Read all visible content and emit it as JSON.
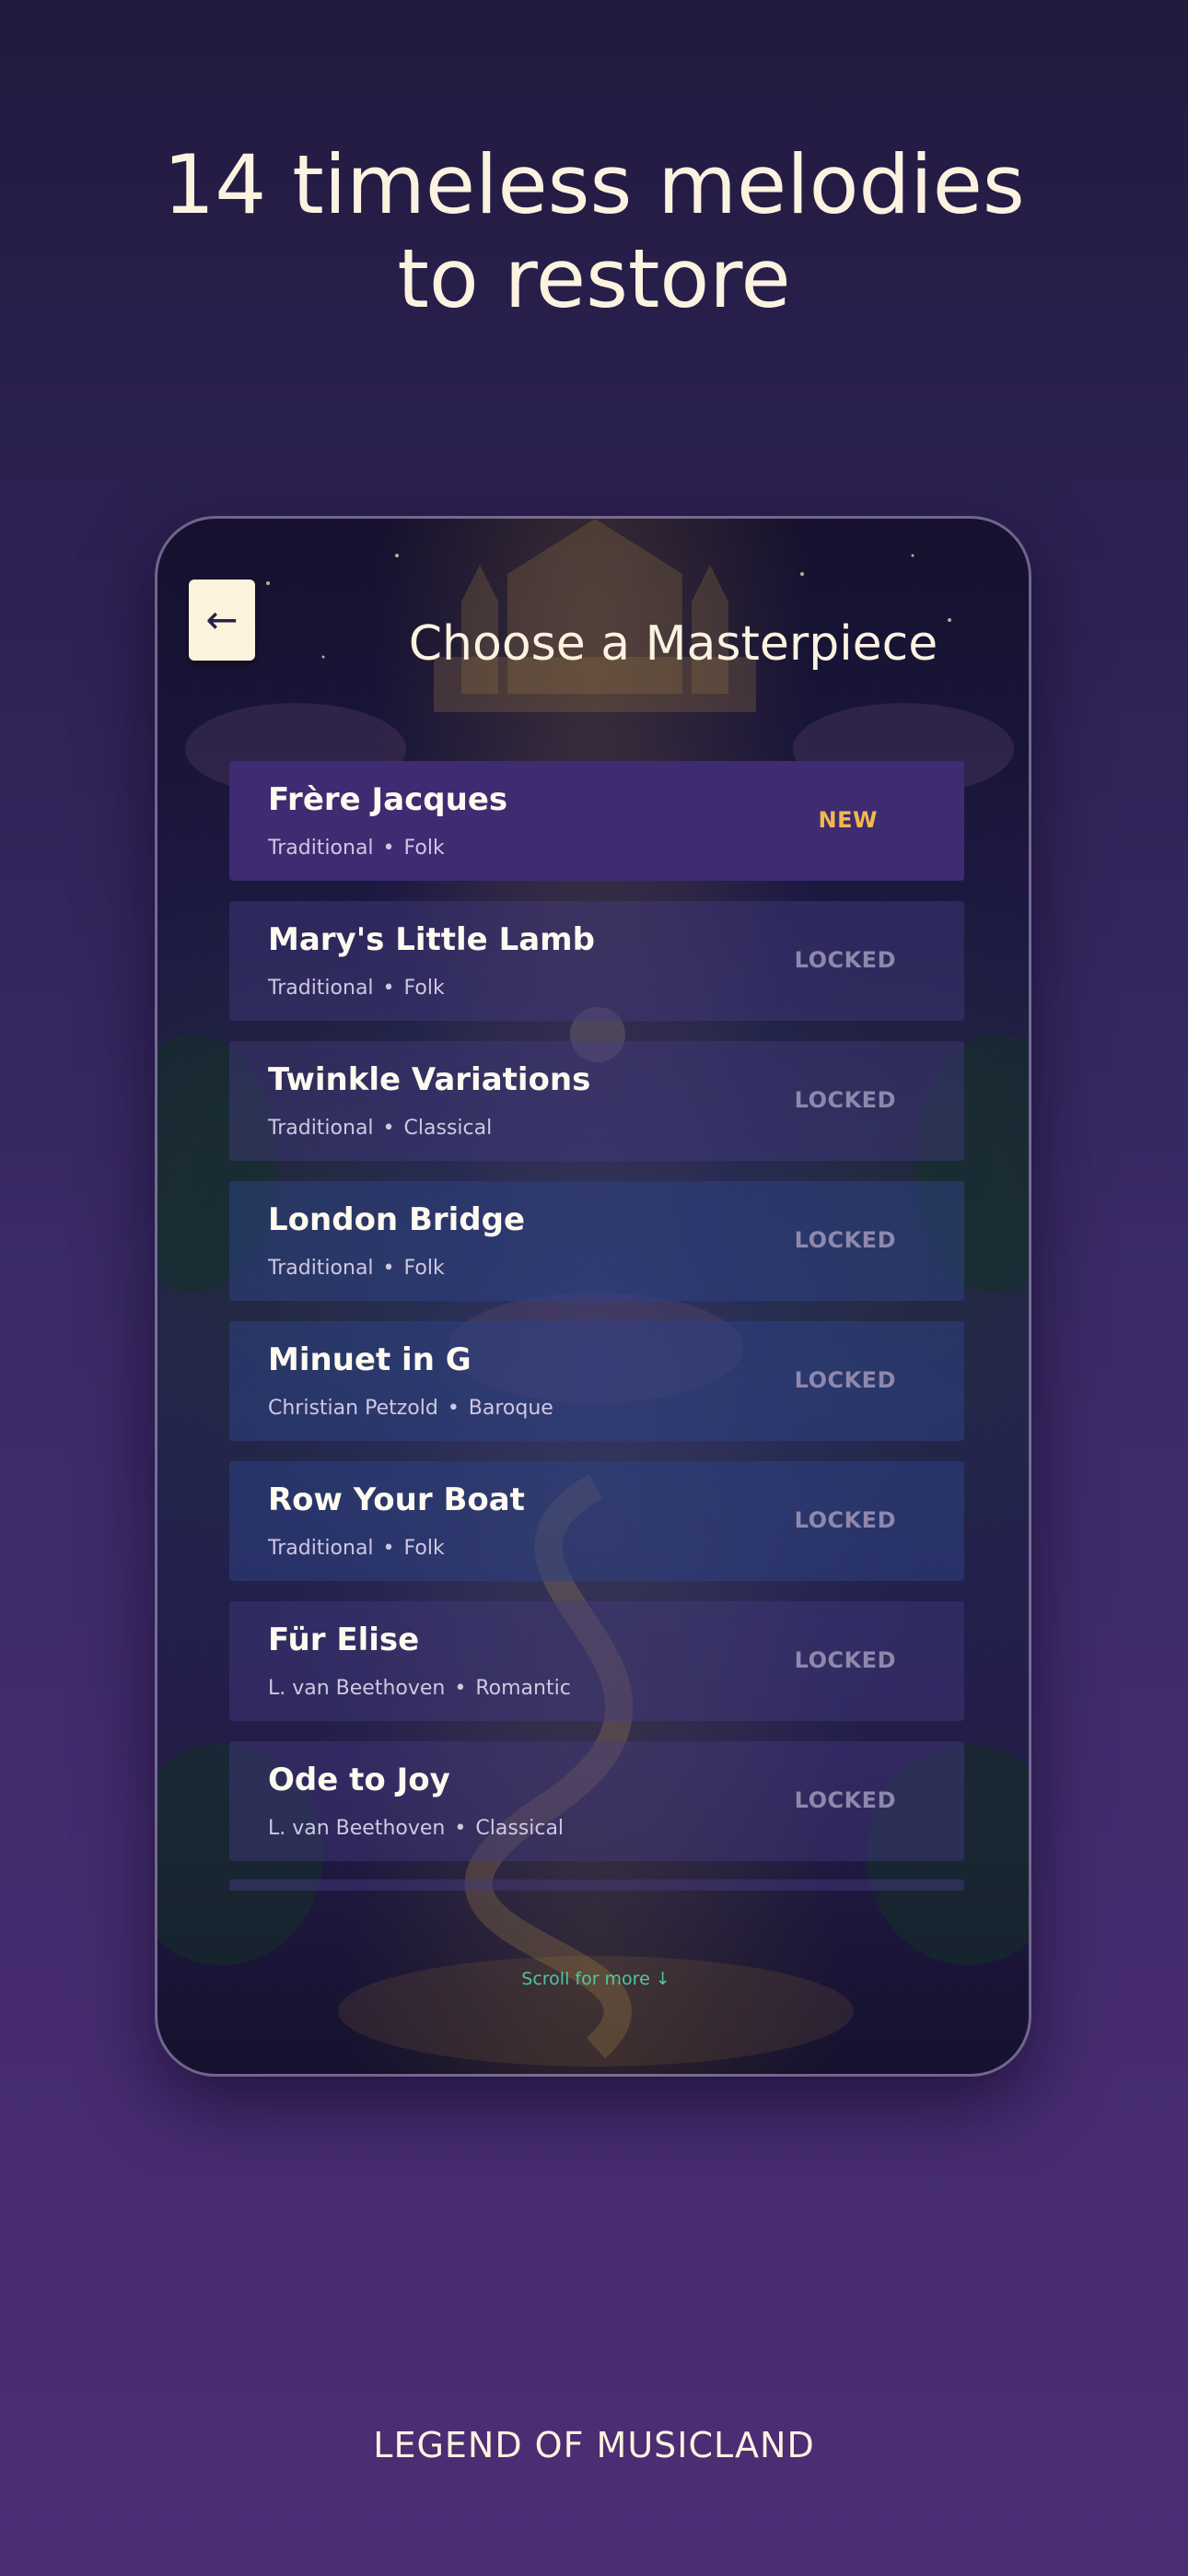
{
  "headline": {
    "line1": "14 timeless melodies",
    "line2": "to restore"
  },
  "screen": {
    "back_icon": "←",
    "title": "Choose a Masterpiece",
    "songs": [
      {
        "name": "Frère Jacques",
        "composer": "Traditional",
        "genre": "Folk",
        "status": "NEW"
      },
      {
        "name": "Mary's Little Lamb",
        "composer": "Traditional",
        "genre": "Folk",
        "status": "LOCKED"
      },
      {
        "name": "Twinkle Variations",
        "composer": "Traditional",
        "genre": "Classical",
        "status": "LOCKED"
      },
      {
        "name": "London Bridge",
        "composer": "Traditional",
        "genre": "Folk",
        "status": "LOCKED"
      },
      {
        "name": "Minuet in G",
        "composer": "Christian Petzold",
        "genre": "Baroque",
        "status": "LOCKED"
      },
      {
        "name": "Row Your Boat",
        "composer": "Traditional",
        "genre": "Folk",
        "status": "LOCKED"
      },
      {
        "name": "Für Elise",
        "composer": "L. van Beethoven",
        "genre": "Romantic",
        "status": "LOCKED"
      },
      {
        "name": "Ode to Joy",
        "composer": "L. van Beethoven",
        "genre": "Classical",
        "status": "LOCKED"
      }
    ],
    "separator": "•",
    "scroll_hint": "Scroll for more ↓"
  },
  "brand": "LEGEND OF MUSICLAND",
  "colors": {
    "new_badge": "#f2b94a",
    "locked_badge": "#8e88ad",
    "scroll_hint": "#4ec6a2",
    "active_row": "#3e2b72"
  }
}
